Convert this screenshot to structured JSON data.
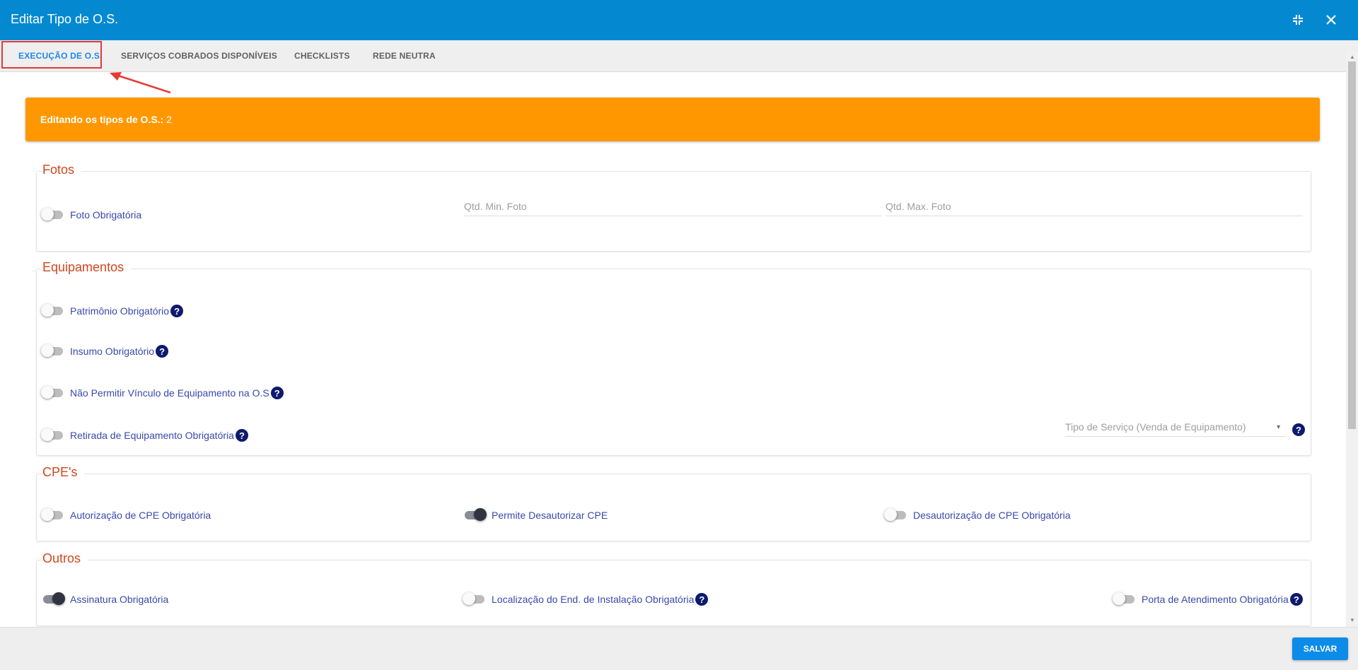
{
  "window": {
    "title": "Editar Tipo de O.S."
  },
  "tabs": [
    {
      "label": "EXECUÇÃO DE O.S.",
      "active": true
    },
    {
      "label": "SERVIÇOS COBRADOS DISPONÍVEIS",
      "active": false
    },
    {
      "label": "CHECKLISTS",
      "active": false
    },
    {
      "label": "REDE NEUTRA",
      "active": false
    }
  ],
  "banner": {
    "label": "Editando os tipos de O.S.:",
    "value": "2"
  },
  "sections": {
    "fotos": {
      "title": "Fotos",
      "foto_obrigatoria": {
        "label": "Foto Obrigatória",
        "on": false
      },
      "qtd_min_placeholder": "Qtd. Min. Foto",
      "qtd_max_placeholder": "Qtd. Max. Foto"
    },
    "equipamentos": {
      "title": "Equipamentos",
      "patrimonio": {
        "label": "Patrimônio Obrigatório",
        "on": false
      },
      "insumo": {
        "label": "Insumo Obrigatório",
        "on": false
      },
      "nao_permitir": {
        "label": "Não Permitir Vínculo de Equipamento na O.S",
        "on": false
      },
      "retirada": {
        "label": "Retirada de Equipamento Obrigatória",
        "on": false
      },
      "tipo_servico_placeholder": "Tipo de Serviço (Venda de Equipamento)"
    },
    "cpes": {
      "title": "CPE's",
      "autorizacao": {
        "label": "Autorização de CPE Obrigatória",
        "on": false
      },
      "permite_desautorizar": {
        "label": "Permite Desautorizar CPE",
        "on": true
      },
      "desautorizacao": {
        "label": "Desautorização de CPE Obrigatória",
        "on": false
      }
    },
    "outros": {
      "title": "Outros",
      "assinatura": {
        "label": "Assinatura Obrigatória",
        "on": true
      },
      "localizacao": {
        "label": "Localização do End. de Instalação Obrigatória",
        "on": false
      },
      "porta": {
        "label": "Porta de Atendimento Obrigatória",
        "on": false
      }
    }
  },
  "help_glyph": "?",
  "footer": {
    "save_label": "SALVAR"
  },
  "colors": {
    "header": "#0489d1",
    "banner": "#ff9800",
    "legend": "#d2461c",
    "label": "#3949ab",
    "save": "#0d8be8"
  }
}
